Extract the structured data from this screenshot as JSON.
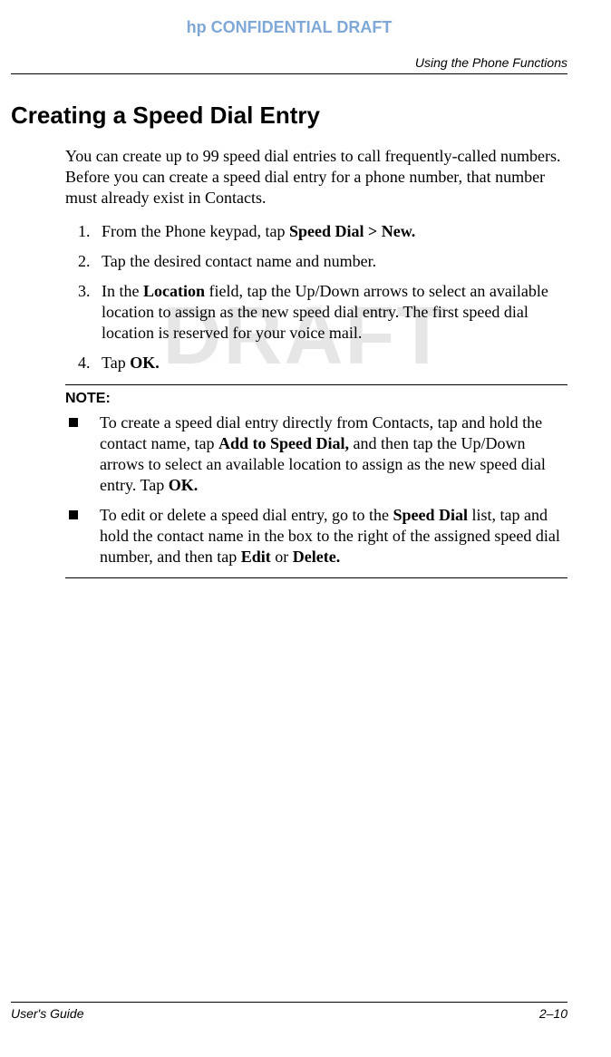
{
  "confidential": "hp CONFIDENTIAL DRAFT",
  "headerRight": "Using the Phone Functions",
  "watermark": "DRAFT",
  "h1": "Creating a Speed Dial Entry",
  "intro": "You can create up to 99 speed dial entries to call frequently-called numbers. Before you can create a speed dial entry for a phone number, that number must already exist in Contacts.",
  "step1_a": "From the Phone keypad, tap ",
  "step1_b": "Speed Dial > New.",
  "step2": "Tap the desired contact name and number.",
  "step3_a": "In the ",
  "step3_b": "Location",
  "step3_c": " field, tap the Up/Down arrows to select an available location to assign as the new speed dial entry. The first speed dial location is reserved for your voice mail.",
  "step4_a": "Tap ",
  "step4_b": "OK.",
  "noteLabel": "NOTE:",
  "note1_a": "To create a speed dial entry directly from Contacts, tap and hold the contact name, tap ",
  "note1_b": "Add to Speed Dial,",
  "note1_c": " and then tap the Up/Down arrows to select an available location to assign as the new speed dial entry. Tap ",
  "note1_d": "OK.",
  "note2_a": "To edit or delete a speed dial entry, go to the ",
  "note2_b": "Speed Dial",
  "note2_c": " list, tap and hold the contact name in the box to the right of the assigned speed dial number, and then tap ",
  "note2_d": "Edit",
  "note2_e": " or ",
  "note2_f": "Delete.",
  "footerLeft": "User's Guide",
  "footerRight": "2–10"
}
